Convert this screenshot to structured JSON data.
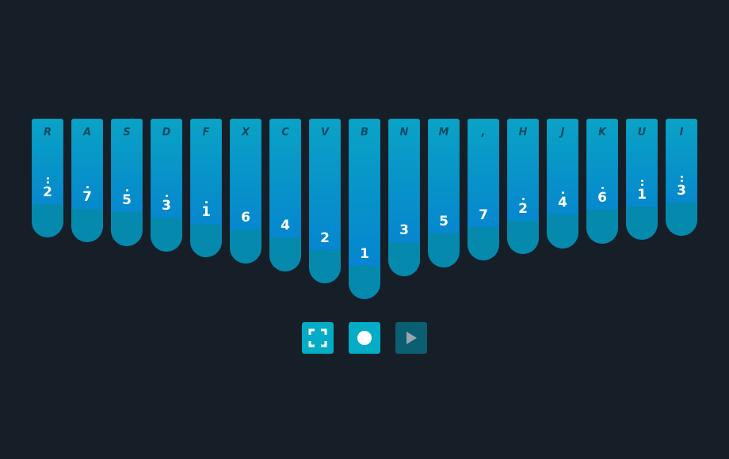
{
  "tines": [
    {
      "key": "R",
      "note": "2",
      "dots": 2
    },
    {
      "key": "A",
      "note": "7",
      "dots": 1
    },
    {
      "key": "S",
      "note": "5",
      "dots": 1
    },
    {
      "key": "D",
      "note": "3",
      "dots": 1
    },
    {
      "key": "F",
      "note": "1",
      "dots": 1
    },
    {
      "key": "X",
      "note": "6",
      "dots": 0
    },
    {
      "key": "C",
      "note": "4",
      "dots": 0
    },
    {
      "key": "V",
      "note": "2",
      "dots": 0
    },
    {
      "key": "B",
      "note": "1",
      "dots": 0
    },
    {
      "key": "N",
      "note": "3",
      "dots": 0
    },
    {
      "key": "M",
      "note": "5",
      "dots": 0
    },
    {
      "key": ",",
      "note": "7",
      "dots": 0
    },
    {
      "key": "H",
      "note": "2",
      "dots": 1
    },
    {
      "key": "J",
      "note": "4",
      "dots": 1
    },
    {
      "key": "K",
      "note": "6",
      "dots": 1
    },
    {
      "key": "U",
      "note": "1",
      "dots": 2
    },
    {
      "key": "I",
      "note": "3",
      "dots": 2
    }
  ],
  "controls": [
    {
      "name": "fullscreen-button",
      "icon": "fullscreen-icon"
    },
    {
      "name": "record-button",
      "icon": "record-icon"
    },
    {
      "name": "play-button",
      "icon": "play-icon"
    }
  ],
  "colors": {
    "background": "#161f28",
    "tine_top": "#0aa3c6",
    "tine_bottom": "#067fd4",
    "tine_cap": "#058aae",
    "key_label": "#0a4b63",
    "control_active": "#04acc6",
    "control_muted": "#0a5f72"
  }
}
